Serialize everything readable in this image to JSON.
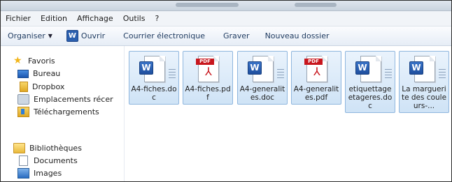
{
  "menu": [
    "Fichier",
    "Edition",
    "Affichage",
    "Outils",
    "?"
  ],
  "toolbar": {
    "organiser": "Organiser",
    "ouvrir": "Ouvrir",
    "courrier": "Courrier électronique",
    "graver": "Graver",
    "nouveau_dossier": "Nouveau dossier"
  },
  "nav": {
    "favoris": "Favoris",
    "bureau": "Bureau",
    "dropbox": "Dropbox",
    "emplacements": "Emplacements récer",
    "telechargements": "Téléchargements",
    "bibliotheques": "Bibliothèques",
    "documents": "Documents",
    "images": "Images"
  },
  "files": [
    {
      "name": "A4-fiches.doc",
      "type": "doc"
    },
    {
      "name": "A4-fiches.pdf",
      "type": "pdf"
    },
    {
      "name": "A4-generalites.doc",
      "type": "doc"
    },
    {
      "name": "A4-generalites.pdf",
      "type": "pdf"
    },
    {
      "name": "etiquettage etageres.doc",
      "type": "doc"
    },
    {
      "name": "La marguerite des couleurs-...",
      "type": "doc"
    }
  ],
  "icons": {
    "word_badge": "W",
    "pdf_tag": "PDF"
  },
  "colors": {
    "selection_bg": "#cfe3f6",
    "selection_border": "#8fb6de",
    "pdf_red": "#c8161d",
    "word_blue": "#2b5fae"
  }
}
